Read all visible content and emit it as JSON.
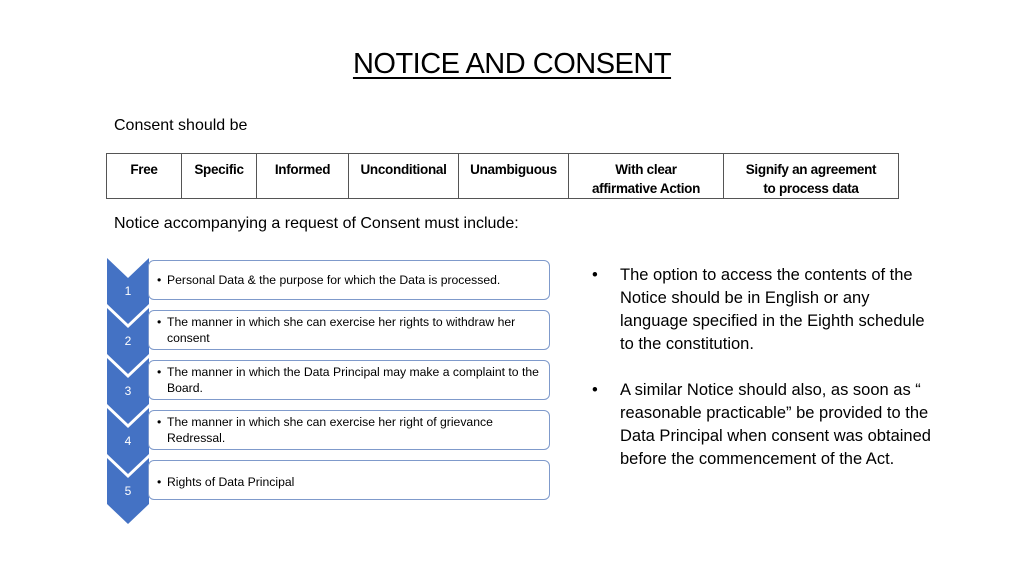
{
  "title": "NOTICE AND CONSENT",
  "consent_label": "Consent should be",
  "consent_qualities": [
    "Free",
    "Specific",
    "Informed",
    "Unconditional",
    "Unambiguous",
    "With clear affirmative Action",
    "Signify an agreement to process data"
  ],
  "notice_label": "Notice accompanying a request of Consent must include:",
  "accent_color": "#4472C4",
  "steps": [
    {
      "number": "1",
      "text": "Personal Data &  the purpose for which the Data is processed."
    },
    {
      "number": "2",
      "text": "The manner in which she can exercise her rights to withdraw her consent"
    },
    {
      "number": "3",
      "text": "The manner in which the Data Principal may make a complaint to the Board."
    },
    {
      "number": "4",
      "text": "The manner in which she can exercise her right of grievance Redressal."
    },
    {
      "number": "5",
      "text": "Rights of Data Principal"
    }
  ],
  "right_bullets": [
    "The option to access the contents of the Notice should be in English or any language specified in the Eighth schedule to the constitution.",
    "A similar Notice should also, as soon as “ reasonable practicable” be provided to the Data Principal when consent was obtained before the commencement of the Act."
  ],
  "bullet_glyph": "•"
}
